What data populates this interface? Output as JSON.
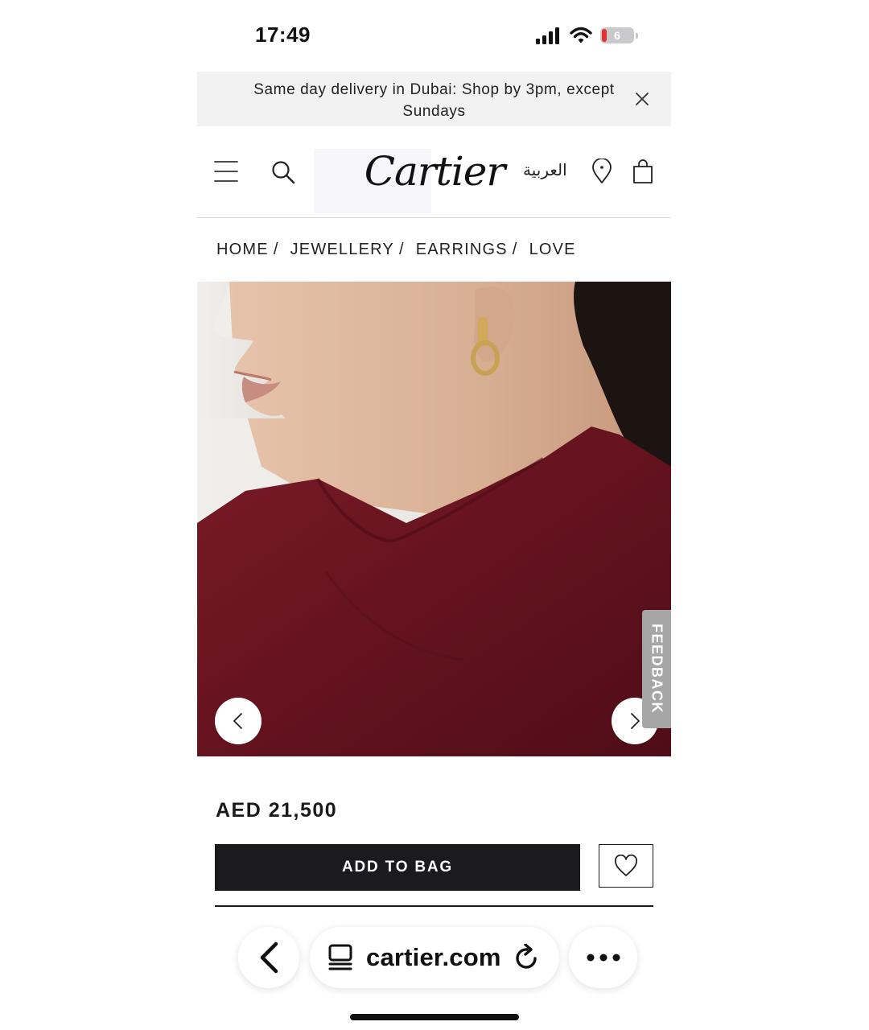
{
  "status_bar": {
    "time": "17:49",
    "battery_level": "6",
    "icons": [
      "cellular-signal-icon",
      "wifi-icon",
      "battery-icon"
    ]
  },
  "promo": {
    "text": "Same day delivery in Dubai: Shop by 3pm, except Sundays",
    "close_icon": "close-icon"
  },
  "header": {
    "logo": "Cartier",
    "language_link": "العربية",
    "icons": [
      "hamburger-menu-icon",
      "search-icon",
      "map-pin-icon",
      "shopping-bag-icon"
    ]
  },
  "breadcrumb": [
    {
      "label": "HOME",
      "sep": "/"
    },
    {
      "label": "JEWELLERY",
      "sep": "/"
    },
    {
      "label": "EARRINGS",
      "sep": "/"
    },
    {
      "label": "LOVE",
      "sep": ""
    }
  ],
  "gallery": {
    "feedback_label": "FEEDBACK",
    "icons": [
      "chevron-left-icon",
      "chevron-right-icon"
    ],
    "colors": {
      "background": "#e9e7e4",
      "garment": "#6b1521",
      "skin": "#ddb8a0",
      "hair": "#1c1411",
      "gold": "#d2a95a"
    }
  },
  "product": {
    "price": "AED 21,500",
    "add_to_bag_label": "ADD TO BAG",
    "wishlist_icon": "heart-icon"
  },
  "browser": {
    "url": "cartier.com",
    "icons": [
      "back-arrow-icon",
      "tabs-icon",
      "reload-icon",
      "more-icon"
    ]
  }
}
